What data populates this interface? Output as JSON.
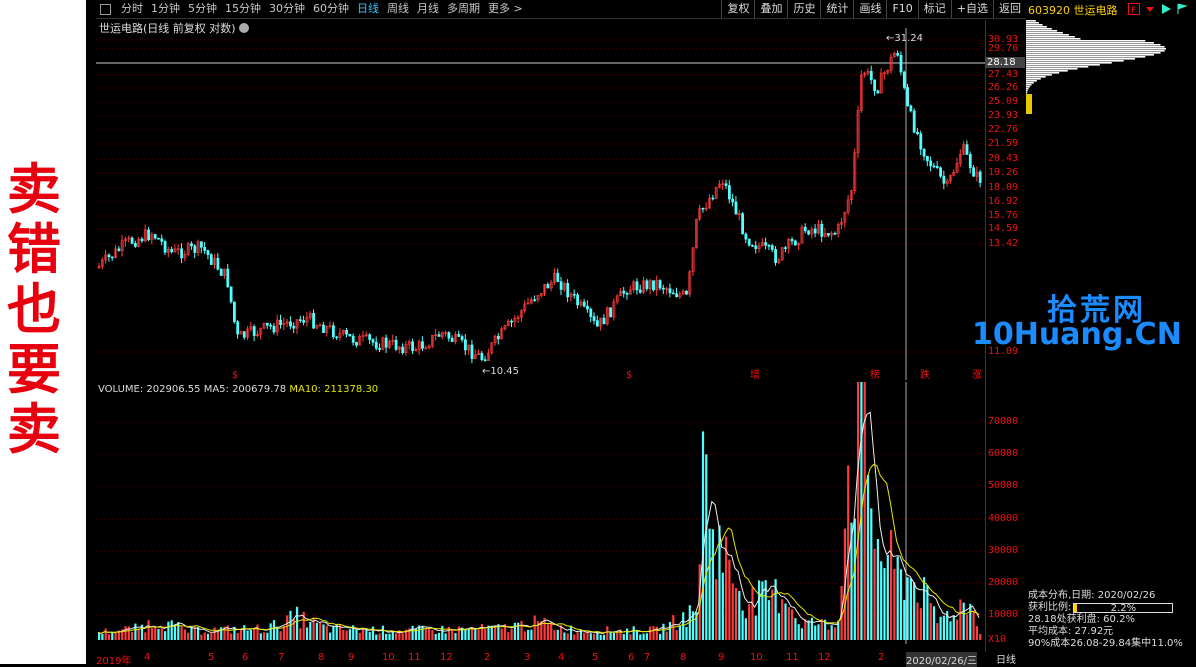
{
  "slogan": [
    "卖",
    "错",
    "也",
    "要",
    "卖"
  ],
  "toolbar": {
    "periods": [
      "分时",
      "1分钟",
      "5分钟",
      "15分钟",
      "30分钟",
      "60分钟",
      "日线",
      "周线",
      "月线",
      "多周期",
      "更多 >"
    ],
    "active_period": "日线",
    "right_buttons": [
      "复权",
      "叠加",
      "历史",
      "统计",
      "画线",
      "F10",
      "标记",
      "+自选",
      "返回"
    ]
  },
  "chart": {
    "title": "世运电路(日线 前复权 对数)",
    "high_label": "31.24",
    "low_label": "10.45",
    "current_price": "28.18",
    "price_ticks": [
      "30.93",
      "29.76",
      "28.18",
      "27.43",
      "26.26",
      "25.09",
      "23.93",
      "22.76",
      "21.59",
      "20.43",
      "19.26",
      "18.09",
      "16.92",
      "15.76",
      "14.59",
      "13.42",
      "11.09"
    ],
    "event_markers": [
      "$",
      "$",
      "增",
      "榜",
      "跌",
      "涨"
    ]
  },
  "volume": {
    "label": "VOLUME: 202906.55",
    "ma5": "MA5: 200679.78",
    "ma10": "MA10: 211378.30",
    "ticks": [
      "70000",
      "60000",
      "50000",
      "40000",
      "30000",
      "20000",
      "10000",
      "X10"
    ]
  },
  "xaxis": {
    "labels": [
      "2019年",
      "4",
      "5",
      "6",
      "7",
      "8",
      "9",
      "10",
      "11",
      "12",
      "2",
      "3",
      "4",
      "5",
      "6",
      "7",
      "8",
      "9",
      "10",
      "11",
      "12",
      "2"
    ],
    "cursor_date": "2020/02/26/三",
    "period": "日线"
  },
  "stock_title": "603920 世运电路",
  "cost": {
    "date_line": "成本分布,日期: 2020/02/26",
    "profit_label": "获利比例:",
    "profit_pct": "2.2%",
    "profit_value": 0.022,
    "line2": "28.18处获利盘: 60.2%",
    "line3": "平均成本: 27.92元",
    "line4": "90%成本26.08-29.84集中11.0%"
  },
  "logo": {
    "top": "拾荒网",
    "bottom": "10Huang.CN"
  },
  "colors": {
    "up": "#ff3b3b",
    "down": "#52ffff",
    "accent": "#39c4ff",
    "axis": "#b0000c"
  }
}
